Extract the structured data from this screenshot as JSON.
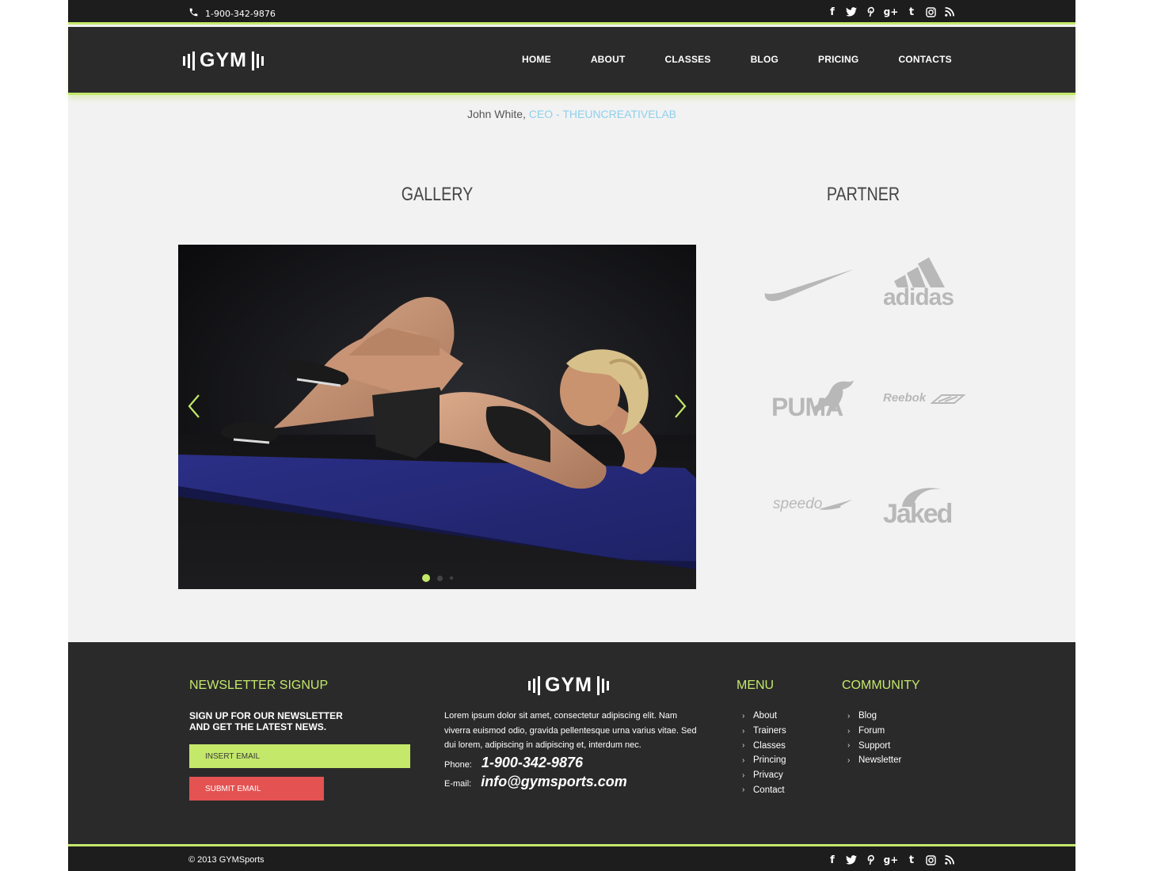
{
  "topbar": {
    "phone": "1-900-342-9876",
    "social_icons": [
      "facebook-icon",
      "twitter-icon",
      "pinterest-icon",
      "google-plus-icon",
      "tumblr-icon",
      "instagram-icon",
      "rss-icon"
    ]
  },
  "header": {
    "logo_text": "GYM",
    "nav": [
      "HOME",
      "ABOUT",
      "CLASSES",
      "BLOG",
      "PRICING",
      "CONTACTS"
    ]
  },
  "testimonial": {
    "author": "John White,",
    "role": "CEO - THEUNCREATIVELAB"
  },
  "gallery": {
    "title": "GALLERY",
    "slide_count": 3,
    "active_slide": 1
  },
  "partners": {
    "title": "PARTNER",
    "logos": [
      "nike",
      "adidas",
      "PUMA",
      "Reebok",
      "speedo",
      "Jaked"
    ]
  },
  "footer": {
    "newsletter": {
      "title": "NEWSLETTER SIGNUP",
      "subtitle_line1": "SIGN UP FOR OUR NEWSLETTER",
      "subtitle_line2": "AND GET THE LATEST NEWS.",
      "email_placeholder": "INSERT EMAIL",
      "submit_label": "SUBMIT EMAIL"
    },
    "logo_text": "GYM",
    "about": "Lorem ipsum dolor sit amet, consectetur adipiscing elit. Nam viverra euismod odio, gravida pellentesque urna varius vitae. Sed dui lorem, adipiscing in adipiscing et, interdum nec.",
    "phone_label": "Phone:",
    "phone": "1-900-342-9876",
    "email_label": "E-mail:",
    "email": "info@gymsports.com",
    "menu": {
      "title": "MENU",
      "items": [
        "About",
        "Trainers",
        "Classes",
        "Princing",
        "Privacy",
        "Contact"
      ]
    },
    "community": {
      "title": "COMMUNITY",
      "items": [
        "Blog",
        "Forum",
        "Support",
        "Newsletter"
      ]
    }
  },
  "bottombar": {
    "copyright": "© 2013 GYMSports"
  },
  "colors": {
    "accent": "#c3e86a",
    "dark": "#2b2a2b",
    "darker": "#1e1d1e",
    "submit": "#e45252",
    "link_blue": "#8fd0ec",
    "background": "#f2f2f2"
  }
}
